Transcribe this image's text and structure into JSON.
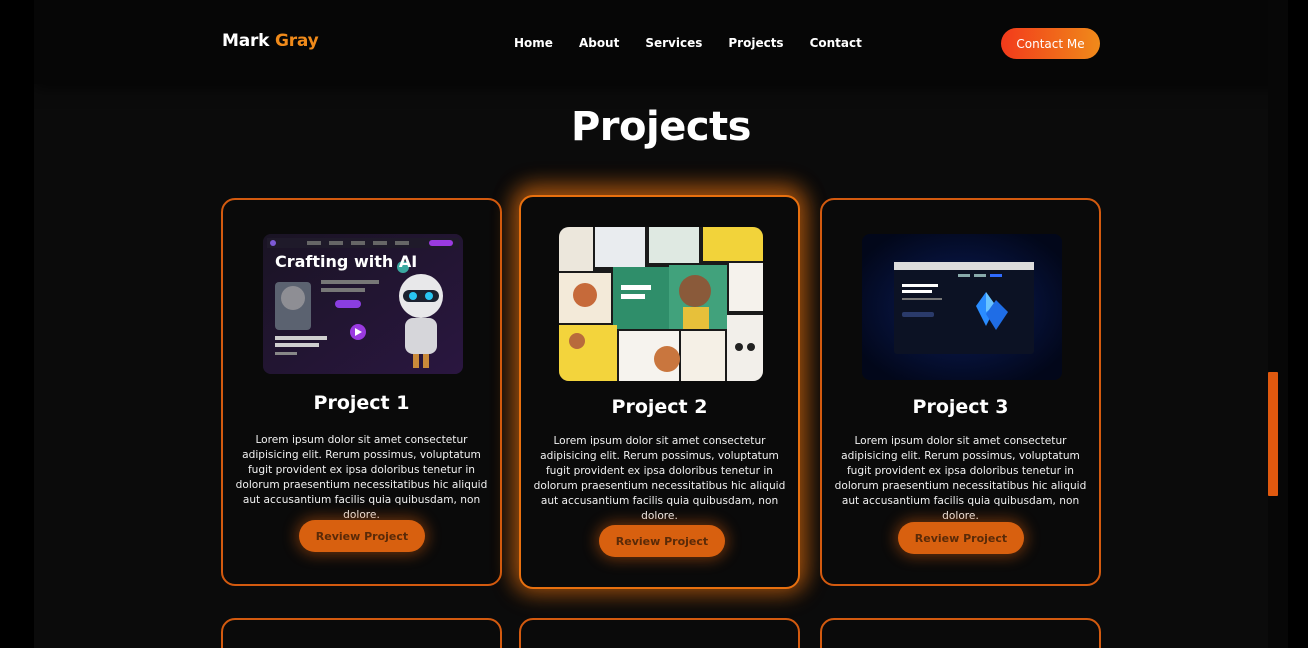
{
  "nav": {
    "logo_first": "Mark",
    "logo_second": "Gray",
    "links": [
      "Home",
      "About",
      "Services",
      "Projects",
      "Contact"
    ],
    "contact_button": "Contact Me"
  },
  "section": {
    "title": "Projects"
  },
  "projects": [
    {
      "title": "Project 1",
      "description": "Lorem ipsum dolor sit amet consectetur adipisicing elit. Rerum possimus, voluptatum fugit provident ex ipsa doloribus tenetur in dolorum praesentium necessitatibus hic aliquid aut accusantium facilis quia quibusdam, non dolore.",
      "button": "Review Project",
      "thumb_headline": "Crafting with AI"
    },
    {
      "title": "Project 2",
      "description": "Lorem ipsum dolor sit amet consectetur adipisicing elit. Rerum possimus, voluptatum fugit provident ex ipsa doloribus tenetur in dolorum praesentium necessitatibus hic aliquid aut accusantium facilis quia quibusdam, non dolore.",
      "button": "Review Project"
    },
    {
      "title": "Project 3",
      "description": "Lorem ipsum dolor sit amet consectetur adipisicing elit. Rerum possimus, voluptatum fugit provident ex ipsa doloribus tenetur in dolorum praesentium necessitatibus hic aliquid aut accusantium facilis quia quibusdam, non dolore.",
      "button": "Review Project"
    }
  ],
  "colors": {
    "accent": "#f08a1a",
    "card_border": "#d35a0f",
    "button": "#d8600f",
    "background": "#0b0b0b"
  }
}
